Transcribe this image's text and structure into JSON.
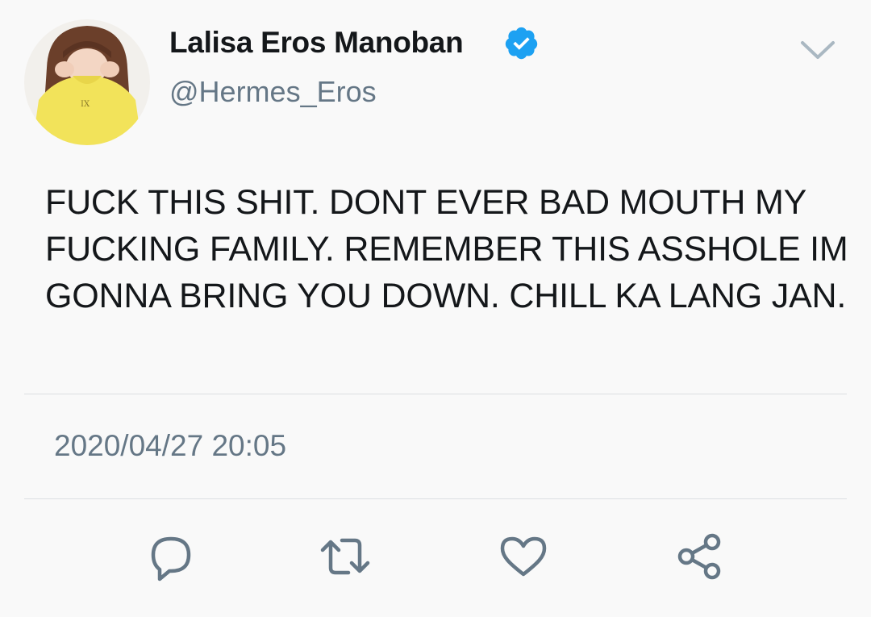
{
  "author": {
    "display_name": "Lalisa Eros Manoban",
    "handle": "@Hermes_Eros",
    "verified": true,
    "avatar_shirt_text": "IX"
  },
  "tweet": {
    "text": "FUCK THIS SHIT. DONT EVER BAD MOUTH MY FUCKING FAMILY. REMEMBER THIS ASSHOLE IM GONNA BRING YOU DOWN. CHILL KA LANG JAN.",
    "timestamp": "2020/04/27 20:05"
  },
  "icons": {
    "menu": "chevron-down-icon",
    "verified": "verified-badge-icon",
    "reply": "reply-icon",
    "retweet": "retweet-icon",
    "like": "heart-icon",
    "share": "share-icon"
  },
  "colors": {
    "background": "#f9f9f9",
    "text_primary": "#14171a",
    "text_secondary": "#657786",
    "verified_blue": "#1da1f2",
    "icon_gray": "#657786",
    "divider": "#dcdfe2"
  }
}
